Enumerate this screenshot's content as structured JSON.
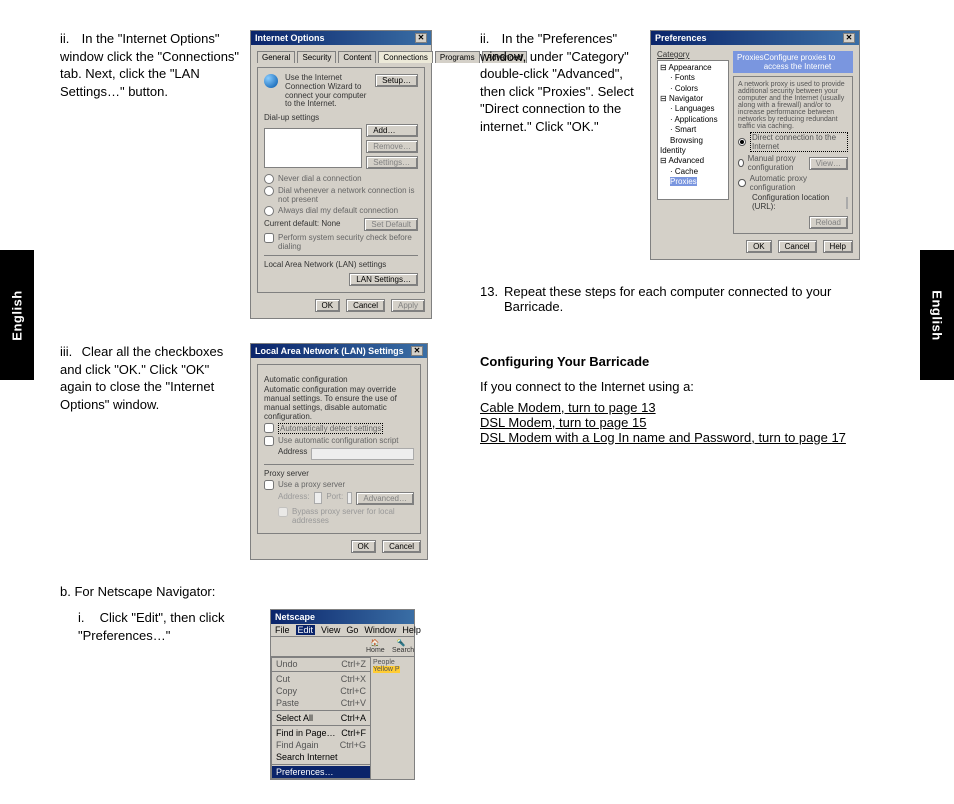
{
  "side_tab": "English",
  "left": {
    "s2": {
      "marker": "ii.",
      "text": "In the \"Internet Options\" window click the \"Connections\" tab.  Next, click the \"LAN Settings…\" button."
    },
    "s3": {
      "marker": "iii.",
      "text": "Clear all the checkboxes and click \"OK.\"  Click \"OK\" again to close the \"Internet Options\" window."
    },
    "sb": {
      "marker": "b.",
      "text": "For Netscape Navigator:"
    },
    "sbi": {
      "marker": "i.",
      "text": "Click \"Edit\", then click \"Preferences…\""
    }
  },
  "right": {
    "s2": {
      "marker": "ii.",
      "text": "In the \"Preferences\" window, under \"Category\" double-click \"Advanced\", then click \"Proxies\".  Select \"Direct connection to the internet.\" Click \"OK.\""
    },
    "step13_num": "13.",
    "step13_text": "Repeat these steps for each computer connected to your Barricade.",
    "heading": "Configuring Your Barricade",
    "intro": "If you connect to the Internet using a:",
    "link1": "Cable Modem, turn to page 13",
    "link2": "DSL Modem, turn to page 15",
    "link3": "DSL Modem with a Log In name and Password, turn to page 17"
  },
  "dlg_io": {
    "title": "Internet Options",
    "tabs": [
      "General",
      "Security",
      "Content",
      "Connections",
      "Programs",
      "Advanced"
    ],
    "wiz": "Use the Internet Connection Wizard to connect your computer to the Internet.",
    "setup": "Setup…",
    "dial_label": "Dial-up settings",
    "add": "Add…",
    "remove": "Remove…",
    "settings": "Settings…",
    "opt1": "Never dial a connection",
    "opt2": "Dial whenever a network connection is not present",
    "opt3": "Always dial my default connection",
    "cur": "Current default:  None",
    "setdef": "Set Default",
    "sys": "Perform system security check before dialing",
    "lan_label": "Local Area Network (LAN) settings",
    "lan_btn": "LAN Settings…",
    "ok": "OK",
    "cancel": "Cancel",
    "apply": "Apply"
  },
  "dlg_lan": {
    "title": "Local Area Network (LAN) Settings",
    "auto_h": "Automatic configuration",
    "auto_t": "Automatic configuration may override manual settings. To ensure the use of manual settings, disable automatic configuration.",
    "c1": "Automatically detect settings",
    "c2": "Use automatic configuration script",
    "addr": "Address",
    "proxy_h": "Proxy server",
    "c3": "Use a proxy server",
    "addr2": "Address:",
    "port": "Port:",
    "adv": "Advanced…",
    "c4": "Bypass proxy server for local addresses",
    "ok": "OK",
    "cancel": "Cancel"
  },
  "dlg_ns": {
    "title": "Netscape",
    "menu": [
      "File",
      "Edit",
      "View",
      "Go",
      "Window",
      "Help"
    ],
    "home": "Home",
    "search": "Search",
    "people": "People",
    "yellow": "Yellow P",
    "undo": "Undo",
    "undo_k": "Ctrl+Z",
    "cut": "Cut",
    "cut_k": "Ctrl+X",
    "copy": "Copy",
    "copy_k": "Ctrl+C",
    "paste": "Paste",
    "paste_k": "Ctrl+V",
    "selall": "Select All",
    "selall_k": "Ctrl+A",
    "find": "Find in Page…",
    "find_k": "Ctrl+F",
    "again": "Find Again",
    "again_k": "Ctrl+G",
    "sint": "Search Internet",
    "prefs": "Preferences…"
  },
  "dlg_pf": {
    "title": "Preferences",
    "cat": "Category",
    "tree": {
      "appearance": "Appearance",
      "fonts": "Fonts",
      "colors": "Colors",
      "navigator": "Navigator",
      "lang": "Languages",
      "apps": "Applications",
      "sb": "Smart Browsing",
      "identity": "Identity",
      "advanced": "Advanced",
      "cache": "Cache",
      "proxies": "Proxies"
    },
    "head_l": "Proxies",
    "head_r": "Configure proxies to access the Internet",
    "blurb": "A network proxy is used to provide additional security between your computer and the Internet (usually along with a firewall) and/or to increase performance between networks by reducing redundant traffic via caching.",
    "r1": "Direct connection to the Internet",
    "r2": "Manual proxy configuration",
    "view": "View…",
    "r3": "Automatic proxy configuration",
    "curl": "Configuration location (URL):",
    "reload": "Reload",
    "ok": "OK",
    "cancel": "Cancel",
    "help": "Help"
  }
}
